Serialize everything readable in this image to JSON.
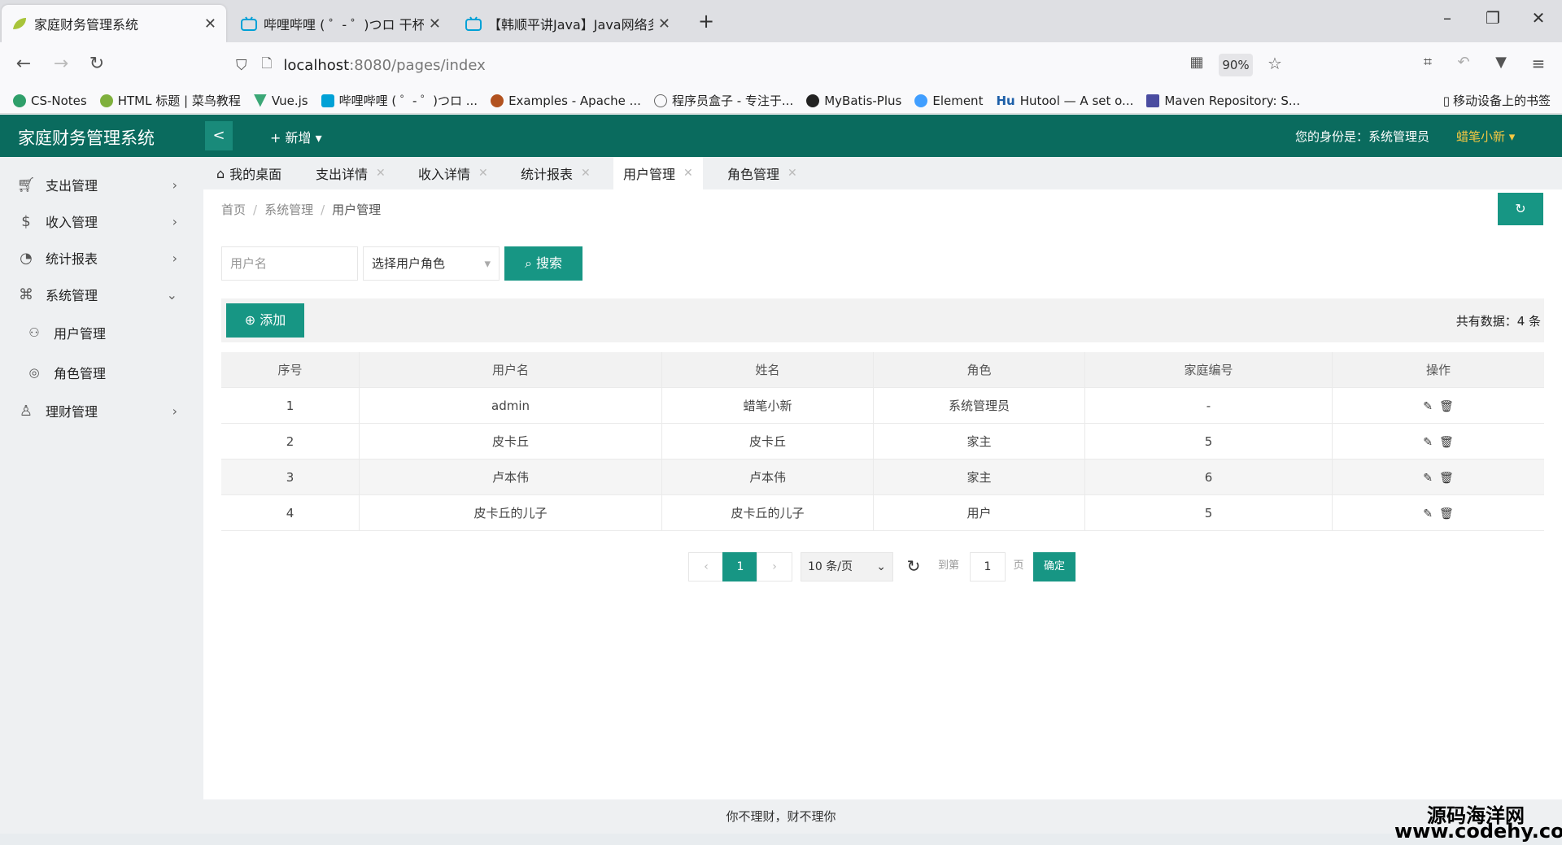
{
  "browser": {
    "tabs": [
      {
        "label": "家庭财务管理系统",
        "active": true
      },
      {
        "label": "哔哩哔哩 ( ゜- ゜)つロ 干杯~-bili",
        "active": false
      },
      {
        "label": "【韩顺平讲Java】Java网络多线",
        "active": false
      }
    ],
    "new_tab": "+",
    "url_host": "localhost",
    "url_rest": ":8080/pages/index",
    "zoom": "90%",
    "bookmarks": [
      "CS-Notes",
      "HTML 标题 | 菜鸟教程",
      "Vue.js",
      "哔哩哔哩 ( ゜- ゜)つロ ...",
      "Examples - Apache ...",
      "程序员盒子 - 专注于...",
      "MyBatis-Plus",
      "Element",
      "Hutool — A set o...",
      "Maven Repository: S..."
    ],
    "mobile_bookmarks": "移动设备上的书签"
  },
  "header": {
    "title": "家庭财务管理系统",
    "collapse": "<",
    "new_menu": "+ 新增",
    "identity": "您的身份是：系统管理员",
    "username": "蜡笔小新"
  },
  "sidebar": {
    "items": [
      {
        "label": "支出管理",
        "icon": "cart-icon"
      },
      {
        "label": "收入管理",
        "icon": "dollar-icon"
      },
      {
        "label": "统计报表",
        "icon": "chart-icon"
      },
      {
        "label": "系统管理",
        "icon": "apps-icon"
      },
      {
        "label": "用户管理",
        "icon": "user-icon"
      },
      {
        "label": "角色管理",
        "icon": "role-icon"
      },
      {
        "label": "理财管理",
        "icon": "person-icon"
      }
    ]
  },
  "page_tabs": [
    {
      "label": "我的桌面",
      "active": false
    },
    {
      "label": "支出详情",
      "active": false
    },
    {
      "label": "收入详情",
      "active": false
    },
    {
      "label": "统计报表",
      "active": false
    },
    {
      "label": "用户管理",
      "active": true
    },
    {
      "label": "角色管理",
      "active": false
    }
  ],
  "breadcrumb": [
    "首页",
    "系统管理",
    "用户管理"
  ],
  "search": {
    "username_placeholder": "用户名",
    "role_select": "选择用户角色",
    "button": "搜索"
  },
  "toolbar": {
    "add_button": "添加",
    "total": "共有数据：4 条"
  },
  "table": {
    "headers": [
      "序号",
      "用户名",
      "姓名",
      "角色",
      "家庭编号",
      "操作"
    ],
    "rows": [
      [
        "1",
        "admin",
        "蜡笔小新",
        "系统管理员",
        "-"
      ],
      [
        "2",
        "皮卡丘",
        "皮卡丘",
        "家主",
        "5"
      ],
      [
        "3",
        "卢本伟",
        "卢本伟",
        "家主",
        "6"
      ],
      [
        "4",
        "皮卡丘的儿子",
        "皮卡丘的儿子",
        "用户",
        "5"
      ]
    ]
  },
  "pager": {
    "prev": "‹",
    "current": "1",
    "next": "›",
    "per_page": "10 条/页",
    "goto_label": "到第",
    "goto_value": "1",
    "page_unit": "页",
    "confirm": "确定"
  },
  "footer": "你不理财，财不理你",
  "watermark": {
    "line1": "源码海洋网",
    "line2": "www.codehy.com"
  },
  "colors": {
    "header": "#0a6b5e",
    "accent": "#179684",
    "username": "#f5c842"
  }
}
